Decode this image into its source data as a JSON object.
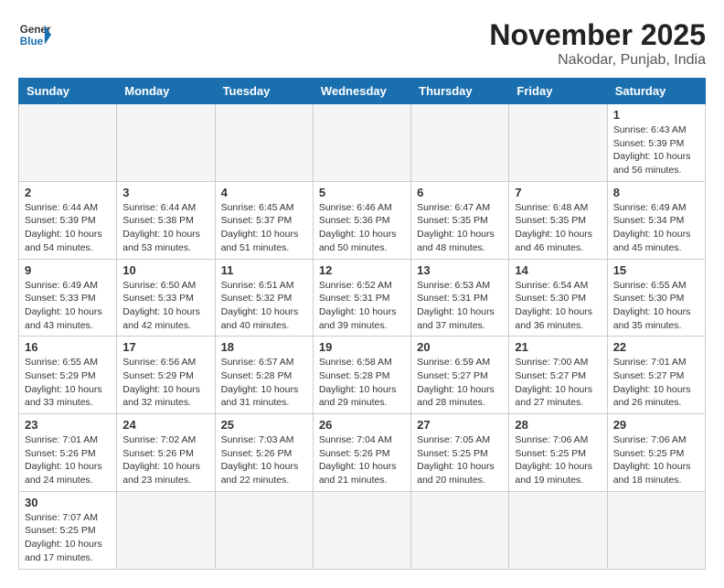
{
  "header": {
    "logo_general": "General",
    "logo_blue": "Blue",
    "month": "November 2025",
    "location": "Nakodar, Punjab, India"
  },
  "weekdays": [
    "Sunday",
    "Monday",
    "Tuesday",
    "Wednesday",
    "Thursday",
    "Friday",
    "Saturday"
  ],
  "weeks": [
    [
      {
        "day": "",
        "info": ""
      },
      {
        "day": "",
        "info": ""
      },
      {
        "day": "",
        "info": ""
      },
      {
        "day": "",
        "info": ""
      },
      {
        "day": "",
        "info": ""
      },
      {
        "day": "",
        "info": ""
      },
      {
        "day": "1",
        "info": "Sunrise: 6:43 AM\nSunset: 5:39 PM\nDaylight: 10 hours and 56 minutes."
      }
    ],
    [
      {
        "day": "2",
        "info": "Sunrise: 6:44 AM\nSunset: 5:39 PM\nDaylight: 10 hours and 54 minutes."
      },
      {
        "day": "3",
        "info": "Sunrise: 6:44 AM\nSunset: 5:38 PM\nDaylight: 10 hours and 53 minutes."
      },
      {
        "day": "4",
        "info": "Sunrise: 6:45 AM\nSunset: 5:37 PM\nDaylight: 10 hours and 51 minutes."
      },
      {
        "day": "5",
        "info": "Sunrise: 6:46 AM\nSunset: 5:36 PM\nDaylight: 10 hours and 50 minutes."
      },
      {
        "day": "6",
        "info": "Sunrise: 6:47 AM\nSunset: 5:35 PM\nDaylight: 10 hours and 48 minutes."
      },
      {
        "day": "7",
        "info": "Sunrise: 6:48 AM\nSunset: 5:35 PM\nDaylight: 10 hours and 46 minutes."
      },
      {
        "day": "8",
        "info": "Sunrise: 6:49 AM\nSunset: 5:34 PM\nDaylight: 10 hours and 45 minutes."
      }
    ],
    [
      {
        "day": "9",
        "info": "Sunrise: 6:49 AM\nSunset: 5:33 PM\nDaylight: 10 hours and 43 minutes."
      },
      {
        "day": "10",
        "info": "Sunrise: 6:50 AM\nSunset: 5:33 PM\nDaylight: 10 hours and 42 minutes."
      },
      {
        "day": "11",
        "info": "Sunrise: 6:51 AM\nSunset: 5:32 PM\nDaylight: 10 hours and 40 minutes."
      },
      {
        "day": "12",
        "info": "Sunrise: 6:52 AM\nSunset: 5:31 PM\nDaylight: 10 hours and 39 minutes."
      },
      {
        "day": "13",
        "info": "Sunrise: 6:53 AM\nSunset: 5:31 PM\nDaylight: 10 hours and 37 minutes."
      },
      {
        "day": "14",
        "info": "Sunrise: 6:54 AM\nSunset: 5:30 PM\nDaylight: 10 hours and 36 minutes."
      },
      {
        "day": "15",
        "info": "Sunrise: 6:55 AM\nSunset: 5:30 PM\nDaylight: 10 hours and 35 minutes."
      }
    ],
    [
      {
        "day": "16",
        "info": "Sunrise: 6:55 AM\nSunset: 5:29 PM\nDaylight: 10 hours and 33 minutes."
      },
      {
        "day": "17",
        "info": "Sunrise: 6:56 AM\nSunset: 5:29 PM\nDaylight: 10 hours and 32 minutes."
      },
      {
        "day": "18",
        "info": "Sunrise: 6:57 AM\nSunset: 5:28 PM\nDaylight: 10 hours and 31 minutes."
      },
      {
        "day": "19",
        "info": "Sunrise: 6:58 AM\nSunset: 5:28 PM\nDaylight: 10 hours and 29 minutes."
      },
      {
        "day": "20",
        "info": "Sunrise: 6:59 AM\nSunset: 5:27 PM\nDaylight: 10 hours and 28 minutes."
      },
      {
        "day": "21",
        "info": "Sunrise: 7:00 AM\nSunset: 5:27 PM\nDaylight: 10 hours and 27 minutes."
      },
      {
        "day": "22",
        "info": "Sunrise: 7:01 AM\nSunset: 5:27 PM\nDaylight: 10 hours and 26 minutes."
      }
    ],
    [
      {
        "day": "23",
        "info": "Sunrise: 7:01 AM\nSunset: 5:26 PM\nDaylight: 10 hours and 24 minutes."
      },
      {
        "day": "24",
        "info": "Sunrise: 7:02 AM\nSunset: 5:26 PM\nDaylight: 10 hours and 23 minutes."
      },
      {
        "day": "25",
        "info": "Sunrise: 7:03 AM\nSunset: 5:26 PM\nDaylight: 10 hours and 22 minutes."
      },
      {
        "day": "26",
        "info": "Sunrise: 7:04 AM\nSunset: 5:26 PM\nDaylight: 10 hours and 21 minutes."
      },
      {
        "day": "27",
        "info": "Sunrise: 7:05 AM\nSunset: 5:25 PM\nDaylight: 10 hours and 20 minutes."
      },
      {
        "day": "28",
        "info": "Sunrise: 7:06 AM\nSunset: 5:25 PM\nDaylight: 10 hours and 19 minutes."
      },
      {
        "day": "29",
        "info": "Sunrise: 7:06 AM\nSunset: 5:25 PM\nDaylight: 10 hours and 18 minutes."
      }
    ],
    [
      {
        "day": "30",
        "info": "Sunrise: 7:07 AM\nSunset: 5:25 PM\nDaylight: 10 hours and 17 minutes."
      },
      {
        "day": "",
        "info": ""
      },
      {
        "day": "",
        "info": ""
      },
      {
        "day": "",
        "info": ""
      },
      {
        "day": "",
        "info": ""
      },
      {
        "day": "",
        "info": ""
      },
      {
        "day": "",
        "info": ""
      }
    ]
  ]
}
